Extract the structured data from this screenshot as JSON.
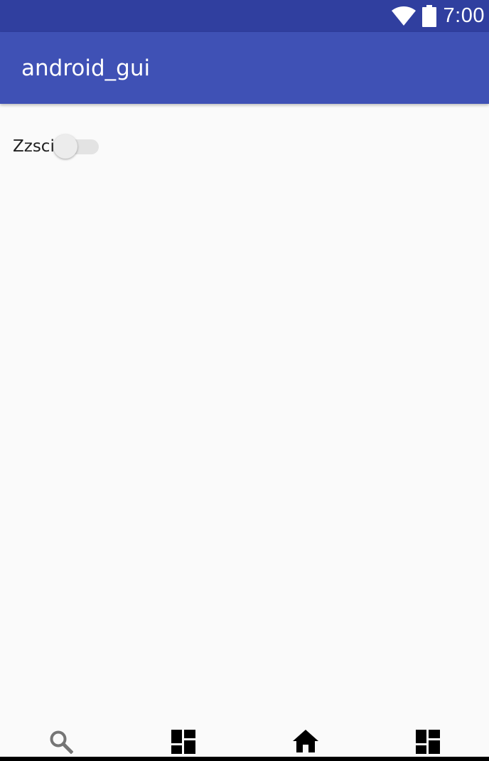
{
  "status_bar": {
    "time": "7:00",
    "icons": [
      "wifi-icon",
      "battery-icon"
    ]
  },
  "app_bar": {
    "title": "android_gui"
  },
  "main": {
    "switch": {
      "label": "Zzsci",
      "checked": false
    }
  },
  "bottom_nav": {
    "items": [
      {
        "icon": "search-icon"
      },
      {
        "icon": "dashboard-icon"
      },
      {
        "icon": "home-icon"
      },
      {
        "icon": "dashboard-icon"
      }
    ]
  },
  "colors": {
    "status_bar": "#303f9f",
    "app_bar": "#3f51b5",
    "background": "#fafafa"
  }
}
